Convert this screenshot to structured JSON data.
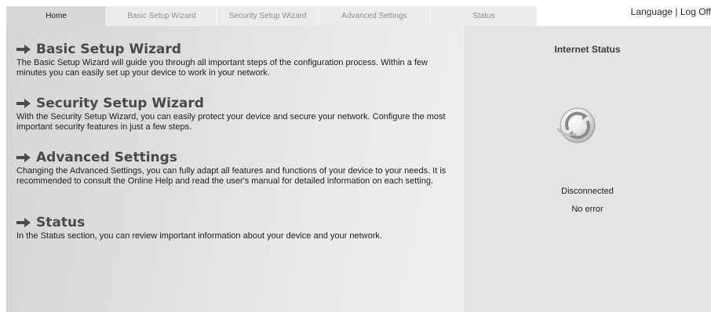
{
  "tabs": [
    {
      "label": "Home",
      "active": true
    },
    {
      "label": "Basic Setup Wizard",
      "active": false
    },
    {
      "label": "Security Setup Wizard",
      "active": false
    },
    {
      "label": "Advanced Settings",
      "active": false
    },
    {
      "label": "Status",
      "active": false
    }
  ],
  "header": {
    "language_label": "Language",
    "separator": "|",
    "logoff_label": "Log Off"
  },
  "sections": [
    {
      "title": "Basic Setup Wizard",
      "text": "The Basic Setup Wizard will guide you through all important steps of the configuration process. Within a few minutes you can easily set up your device to work in your network."
    },
    {
      "title": "Security Setup Wizard",
      "text": "With the Security Setup Wizard, you can easily protect your device and secure your network. Configure the most important security features in just a few steps."
    },
    {
      "title": "Advanced Settings",
      "text": "Changing the Advanced Settings, you can fully adapt all features and functions of your device to your needs. It is recommended to consult the Online Help and read the user's manual for detailed information on each setting."
    },
    {
      "title": "Status",
      "text": "In the Status section, you can review important information about your device and your network."
    }
  ],
  "internet_status": {
    "title": "Internet Status",
    "icon": "connection-refresh-icon",
    "state": "Disconnected",
    "error": "No error"
  },
  "colors": {
    "tab_active_bg": "#d8d8d8",
    "tab_inactive_bg": "#ececec",
    "heading_color": "#4a4a4a",
    "status_panel_bg": "#e4e4e4"
  }
}
